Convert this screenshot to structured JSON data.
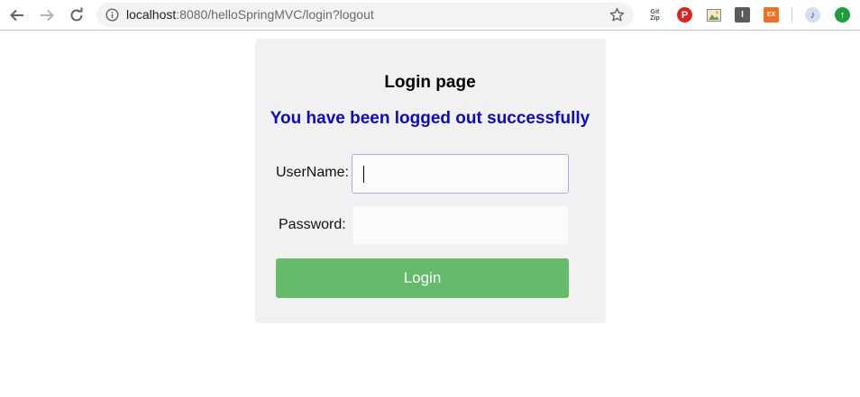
{
  "browser": {
    "url_host": "localhost",
    "url_rest": ":8080/helloSpringMVC/login?logout",
    "extensions": [
      {
        "name": "gitzip-extension",
        "label": "Git Zip"
      },
      {
        "name": "pinterest-extension",
        "label": "P"
      },
      {
        "name": "image-extension",
        "label": ""
      },
      {
        "name": "instapaper-extension",
        "label": "I"
      },
      {
        "name": "ex-extension",
        "label": "EX"
      },
      {
        "name": "music-extension",
        "label": "♪"
      },
      {
        "name": "update-extension",
        "label": "↑"
      }
    ]
  },
  "page": {
    "title": "Login page",
    "logout_message": "You have been logged out successfully",
    "username_label": "UserName:",
    "username_value": "",
    "password_label": "Password:",
    "password_value": "",
    "login_button": "Login"
  },
  "colors": {
    "message": "#0a0ac8",
    "button": "#66bb6a",
    "card": "#f1f1f1"
  }
}
